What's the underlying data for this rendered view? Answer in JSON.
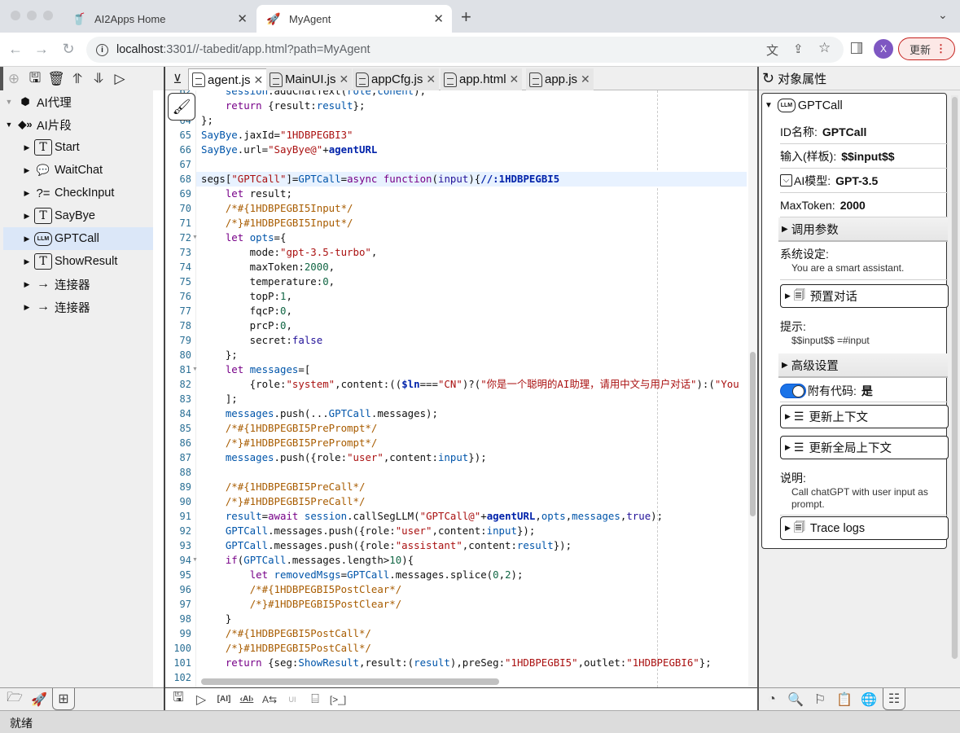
{
  "browser": {
    "tabs": [
      {
        "title": "AI2Apps Home",
        "icon": "cup-icon",
        "active": false
      },
      {
        "title": "MyAgent",
        "icon": "rocket-icon",
        "active": true
      }
    ],
    "new_tab": "+",
    "tab_menu": "⌄",
    "url_host": "localhost",
    "url_rest": ":3301//-tabedit/app.html?path=MyAgent",
    "profile_initial": "X",
    "update_label": "更新"
  },
  "left_toolbar": [
    "add-icon",
    "save-icon",
    "delete-icon",
    "export-icon",
    "import-icon",
    "run-icon"
  ],
  "tree": {
    "items": [
      {
        "label": "AI代理",
        "icon": "cube-icon",
        "level": 0,
        "expanded": true,
        "disabled_arrow": true
      },
      {
        "label": "AI片段",
        "icon": "segments-icon",
        "level": 0,
        "expanded": true
      },
      {
        "label": "Start",
        "icon": "text-icon",
        "level": 1
      },
      {
        "label": "WaitChat",
        "icon": "chat-icon",
        "level": 1
      },
      {
        "label": "CheckInput",
        "icon": "condition-icon",
        "level": 1
      },
      {
        "label": "SayBye",
        "icon": "text-icon",
        "level": 1
      },
      {
        "label": "GPTCall",
        "icon": "llm-icon",
        "level": 1,
        "selected": true
      },
      {
        "label": "ShowResult",
        "icon": "text-icon",
        "level": 1
      },
      {
        "label": "连接器",
        "icon": "arrow-icon",
        "level": 1
      },
      {
        "label": "连接器",
        "icon": "arrow-icon",
        "level": 1
      }
    ]
  },
  "file_tabs": [
    {
      "label": "agent.js",
      "active": true
    },
    {
      "label": "MainUI.js",
      "active": false
    },
    {
      "label": "appCfg.js",
      "active": false
    },
    {
      "label": "app.html",
      "active": false
    },
    {
      "label": "app.js",
      "active": false
    }
  ],
  "editor": {
    "first_line": 62,
    "highlighted_line": 68,
    "fold_lines": [
      72,
      81,
      94
    ],
    "lines": [
      [
        [
          "    session",
          "v"
        ],
        [
          ".addChatText(",
          ""
        ],
        [
          "role",
          "v"
        ],
        [
          ",",
          ""
        ],
        [
          "conent",
          "v"
        ],
        [
          ");",
          ""
        ]
      ],
      [
        [
          "    ",
          ""
        ],
        [
          "return",
          "k"
        ],
        [
          " {result:",
          ""
        ],
        [
          "result",
          "v"
        ],
        [
          "};",
          ""
        ]
      ],
      [
        [
          "};",
          ""
        ]
      ],
      [
        [
          "SayBye",
          "v"
        ],
        [
          ".jaxId=",
          ""
        ],
        [
          "\"1HDBPEGBI3\"",
          "s"
        ]
      ],
      [
        [
          "SayBye",
          "v"
        ],
        [
          ".url=",
          ""
        ],
        [
          "\"SayBye@\"",
          "s"
        ],
        [
          "+",
          ""
        ],
        [
          "agentURL",
          "b"
        ]
      ],
      [
        [
          "",
          ""
        ]
      ],
      [
        [
          "segs[",
          ""
        ],
        [
          "\"GPTCall\"",
          "s"
        ],
        [
          "]=",
          ""
        ],
        [
          "GPTCall",
          "v"
        ],
        [
          "=",
          ""
        ],
        [
          "async",
          "k"
        ],
        [
          " ",
          ""
        ],
        [
          "function",
          "k"
        ],
        [
          "(",
          ""
        ],
        [
          "input",
          "d"
        ],
        [
          "){",
          ""
        ],
        [
          "//:1HDBPEGBI5",
          "b"
        ]
      ],
      [
        [
          "    ",
          ""
        ],
        [
          "let",
          "k"
        ],
        [
          " result;",
          ""
        ]
      ],
      [
        [
          "    ",
          ""
        ],
        [
          "/*#{1HDBPEGBI5Input*/",
          "c"
        ]
      ],
      [
        [
          "    ",
          ""
        ],
        [
          "/*}#1HDBPEGBI5Input*/",
          "c"
        ]
      ],
      [
        [
          "    ",
          ""
        ],
        [
          "let",
          "k"
        ],
        [
          " ",
          ""
        ],
        [
          "opts",
          "v"
        ],
        [
          "={",
          ""
        ]
      ],
      [
        [
          "        mode:",
          ""
        ],
        [
          "\"gpt-3.5-turbo\"",
          "s"
        ],
        [
          ",",
          ""
        ]
      ],
      [
        [
          "        maxToken:",
          ""
        ],
        [
          "2000",
          "n"
        ],
        [
          ",",
          ""
        ]
      ],
      [
        [
          "        temperature:",
          ""
        ],
        [
          "0",
          "n"
        ],
        [
          ",",
          ""
        ]
      ],
      [
        [
          "        topP:",
          ""
        ],
        [
          "1",
          "n"
        ],
        [
          ",",
          ""
        ]
      ],
      [
        [
          "        fqcP:",
          ""
        ],
        [
          "0",
          "n"
        ],
        [
          ",",
          ""
        ]
      ],
      [
        [
          "        prcP:",
          ""
        ],
        [
          "0",
          "n"
        ],
        [
          ",",
          ""
        ]
      ],
      [
        [
          "        secret:",
          ""
        ],
        [
          "false",
          "d"
        ]
      ],
      [
        [
          "    };",
          ""
        ]
      ],
      [
        [
          "    ",
          ""
        ],
        [
          "let",
          "k"
        ],
        [
          " ",
          ""
        ],
        [
          "messages",
          "v"
        ],
        [
          "=[",
          ""
        ]
      ],
      [
        [
          "        {role:",
          ""
        ],
        [
          "\"system\"",
          "s"
        ],
        [
          ",content:((",
          ""
        ],
        [
          "$ln",
          "b"
        ],
        [
          "===",
          ""
        ],
        [
          "\"CN\"",
          "s"
        ],
        [
          ")?(",
          ""
        ],
        [
          "\"你是一个聪明的AI助理，请用中文与用户对话\"",
          "s"
        ],
        [
          "):(",
          ""
        ],
        [
          "\"You",
          "s"
        ]
      ],
      [
        [
          "    ];",
          ""
        ]
      ],
      [
        [
          "    ",
          ""
        ],
        [
          "messages",
          "v"
        ],
        [
          ".push(...",
          ""
        ],
        [
          "GPTCall",
          "v"
        ],
        [
          ".messages);",
          ""
        ]
      ],
      [
        [
          "    ",
          ""
        ],
        [
          "/*#{1HDBPEGBI5PrePrompt*/",
          "c"
        ]
      ],
      [
        [
          "    ",
          ""
        ],
        [
          "/*}#1HDBPEGBI5PrePrompt*/",
          "c"
        ]
      ],
      [
        [
          "    ",
          ""
        ],
        [
          "messages",
          "v"
        ],
        [
          ".push({role:",
          ""
        ],
        [
          "\"user\"",
          "s"
        ],
        [
          ",content:",
          ""
        ],
        [
          "input",
          "v"
        ],
        [
          "});",
          ""
        ]
      ],
      [
        [
          "",
          ""
        ]
      ],
      [
        [
          "    ",
          ""
        ],
        [
          "/*#{1HDBPEGBI5PreCall*/",
          "c"
        ]
      ],
      [
        [
          "    ",
          ""
        ],
        [
          "/*}#1HDBPEGBI5PreCall*/",
          "c"
        ]
      ],
      [
        [
          "    ",
          ""
        ],
        [
          "result",
          "v"
        ],
        [
          "=",
          ""
        ],
        [
          "await",
          "k"
        ],
        [
          " ",
          ""
        ],
        [
          "session",
          "v"
        ],
        [
          ".callSegLLM(",
          ""
        ],
        [
          "\"GPTCall@\"",
          "s"
        ],
        [
          "+",
          ""
        ],
        [
          "agentURL",
          "b"
        ],
        [
          ",",
          ""
        ],
        [
          "opts",
          "v"
        ],
        [
          ",",
          ""
        ],
        [
          "messages",
          "v"
        ],
        [
          ",",
          ""
        ],
        [
          "true",
          "d"
        ],
        [
          ");",
          ""
        ]
      ],
      [
        [
          "    ",
          ""
        ],
        [
          "GPTCall",
          "v"
        ],
        [
          ".messages.push({role:",
          ""
        ],
        [
          "\"user\"",
          "s"
        ],
        [
          ",content:",
          ""
        ],
        [
          "input",
          "v"
        ],
        [
          "});",
          ""
        ]
      ],
      [
        [
          "    ",
          ""
        ],
        [
          "GPTCall",
          "v"
        ],
        [
          ".messages.push({role:",
          ""
        ],
        [
          "\"assistant\"",
          "s"
        ],
        [
          ",content:",
          ""
        ],
        [
          "result",
          "v"
        ],
        [
          "});",
          ""
        ]
      ],
      [
        [
          "    ",
          ""
        ],
        [
          "if",
          "k"
        ],
        [
          "(",
          ""
        ],
        [
          "GPTCall",
          "v"
        ],
        [
          ".messages.length>",
          ""
        ],
        [
          "10",
          "n"
        ],
        [
          "){",
          ""
        ]
      ],
      [
        [
          "        ",
          ""
        ],
        [
          "let",
          "k"
        ],
        [
          " ",
          ""
        ],
        [
          "removedMsgs",
          "v"
        ],
        [
          "=",
          ""
        ],
        [
          "GPTCall",
          "v"
        ],
        [
          ".messages.splice(",
          ""
        ],
        [
          "0",
          "n"
        ],
        [
          ",",
          ""
        ],
        [
          "2",
          "n"
        ],
        [
          ");",
          ""
        ]
      ],
      [
        [
          "        ",
          ""
        ],
        [
          "/*#{1HDBPEGBI5PostClear*/",
          "c"
        ]
      ],
      [
        [
          "        ",
          ""
        ],
        [
          "/*}#1HDBPEGBI5PostClear*/",
          "c"
        ]
      ],
      [
        [
          "    }",
          ""
        ]
      ],
      [
        [
          "    ",
          ""
        ],
        [
          "/*#{1HDBPEGBI5PostCall*/",
          "c"
        ]
      ],
      [
        [
          "    ",
          ""
        ],
        [
          "/*}#1HDBPEGBI5PostCall*/",
          "c"
        ]
      ],
      [
        [
          "    ",
          ""
        ],
        [
          "return",
          "k"
        ],
        [
          " {seg:",
          ""
        ],
        [
          "ShowResult",
          "v"
        ],
        [
          ",result:(",
          ""
        ],
        [
          "result",
          "v"
        ],
        [
          "),preSeg:",
          ""
        ],
        [
          "\"1HDBPEGBI5\"",
          "s"
        ],
        [
          ",outlet:",
          ""
        ],
        [
          "\"1HDBPEGBI6\"",
          "s"
        ],
        [
          "};",
          ""
        ]
      ],
      [
        [
          "",
          ""
        ]
      ]
    ]
  },
  "editor_toolbar": [
    "save-icon",
    "run-icon",
    "ai-chat-icon",
    "ai-doc-icon",
    "translate-icon",
    "ui-ai-icon",
    "drive-icon",
    "terminal-icon"
  ],
  "left_bottom_tabs": [
    {
      "icon": "folder-icon",
      "active": false
    },
    {
      "icon": "rocket-icon",
      "active": false
    },
    {
      "icon": "tree-icon",
      "active": true
    }
  ],
  "status": "就绪",
  "props": {
    "header": "对象属性",
    "object_name": "GPTCall",
    "fields": {
      "id_label": "ID名称:",
      "id_value": "GPTCall",
      "input_label": "输入(样板):",
      "input_value": "$$input$$",
      "model_label": "AI模型:",
      "model_value": "GPT-3.5",
      "maxtoken_label": "MaxToken:",
      "maxtoken_value": "2000"
    },
    "section_call_params": "调用参数",
    "system_label": "系统设定:",
    "system_value": "You are a smart assistant.",
    "preset_dialog": "预置对话",
    "prompt_label": "提示:",
    "prompt_value": "$$input$$ =#input",
    "section_advanced": "高级设置",
    "with_code_label": "附有代码:",
    "with_code_value": "是",
    "with_code_on": true,
    "update_context": "更新上下文",
    "update_global_context": "更新全局上下文",
    "desc_label": "说明:",
    "desc_value": "Call chatGPT with user input as prompt.",
    "trace_logs": "Trace logs"
  },
  "right_bottom_tabs": [
    {
      "icon": "history-icon",
      "active": false
    },
    {
      "icon": "find-files-icon",
      "active": false
    },
    {
      "icon": "flag-icon",
      "active": false
    },
    {
      "icon": "clipboard-check-icon",
      "active": false
    },
    {
      "icon": "globe-icon",
      "active": false
    },
    {
      "icon": "sliders-icon",
      "active": true
    }
  ]
}
